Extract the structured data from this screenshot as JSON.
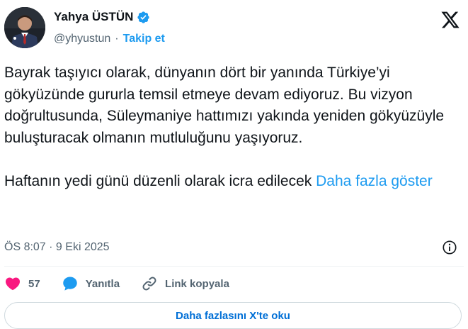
{
  "author": {
    "name": "Yahya ÜSTÜN",
    "handle": "@yhyustun",
    "separator": "·",
    "follow_label": "Takip et"
  },
  "tweet": {
    "paragraph1": "Bayrak taşıyıcı olarak, dünyanın dört bir yanında Türkiye’yi gökyüzünde gururla temsil etmeye devam ediyoruz. Bu vizyon doğrultusunda, Süleymaniye hattımızı yakında yeniden gökyüzüyle buluşturacak olmanın mutluluğunu yaşıyoruz.",
    "paragraph2": "Haftanın yedi günü düzenli olarak icra edilecek ",
    "show_more": "Daha fazla göster"
  },
  "meta": {
    "timestamp": "ÖS 8:07 · 9 Eki 2025"
  },
  "actions": {
    "like_count": "57",
    "reply_label": "Yanıtla",
    "copy_link_label": "Link kopyala"
  },
  "read_more_button": "Daha fazlasını X'te oku",
  "colors": {
    "accent": "#1d9bf0",
    "like": "#f91880",
    "text": "#0f1419",
    "muted": "#536471"
  },
  "icons": [
    "verified-badge-icon",
    "x-logo-icon",
    "info-icon",
    "heart-icon",
    "reply-icon",
    "link-icon"
  ]
}
